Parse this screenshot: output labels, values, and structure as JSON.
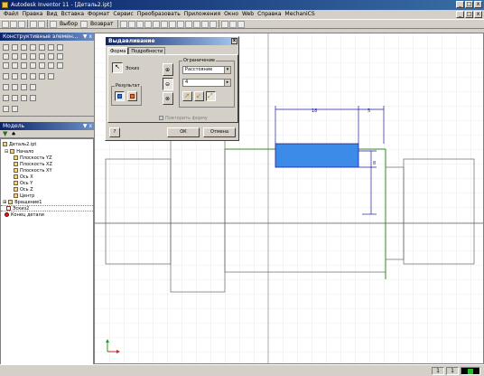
{
  "window": {
    "title": "Autodesk Inventor 11 - [Деталь2.ipt]",
    "controls": [
      "_",
      "□",
      "x"
    ],
    "doc_controls": [
      "_",
      "□",
      "x"
    ]
  },
  "menu": [
    "Файл",
    "Правка",
    "Вид",
    "Вставка",
    "Формат",
    "Сервис",
    "Преобразовать",
    "Приложения",
    "Окно",
    "Web",
    "Справка",
    "MechaniCS"
  ],
  "toolbar": {
    "select_label": "Выбор",
    "back_label": "Возврат"
  },
  "left_panel": {
    "tools_title": "Конструктивные элемен...",
    "model_title": "Модель",
    "browser_items": [
      {
        "label": "Деталь2.ipt",
        "depth": 0
      },
      {
        "label": "Начало",
        "depth": 1
      },
      {
        "label": "Плоскость YZ",
        "depth": 2
      },
      {
        "label": "Плоскость XZ",
        "depth": 2
      },
      {
        "label": "Плоскость XY",
        "depth": 2
      },
      {
        "label": "Ось X",
        "depth": 2
      },
      {
        "label": "Ось Y",
        "depth": 2
      },
      {
        "label": "Ось Z",
        "depth": 2
      },
      {
        "label": "Центр",
        "depth": 2
      },
      {
        "label": "Вращение1",
        "depth": 0
      },
      {
        "label": "Эскиз2",
        "depth": 0
      },
      {
        "label": "Конец детали",
        "depth": 0
      }
    ]
  },
  "dialog": {
    "title": "Выдавливание",
    "tabs": [
      "Форма",
      "Подробности"
    ],
    "sketch_label": "Эскиз",
    "result_label": "Результат",
    "limit_label": "Ограничение",
    "limit_value": "Расстояние",
    "distance_value": "4",
    "match_shape": "Повторить форму",
    "ok_label": "ОК",
    "cancel_label": "Отмена",
    "help_label": "?"
  },
  "dimensions": {
    "d1": "18",
    "d2": "5",
    "d3": "8",
    "d4": "4"
  },
  "status": {
    "cell1": "1",
    "cell2": "1"
  },
  "colors": {
    "profile_fill": "#3c8be8",
    "dim_line": "#1d1d9c",
    "axis_green": "#3a8a26"
  }
}
